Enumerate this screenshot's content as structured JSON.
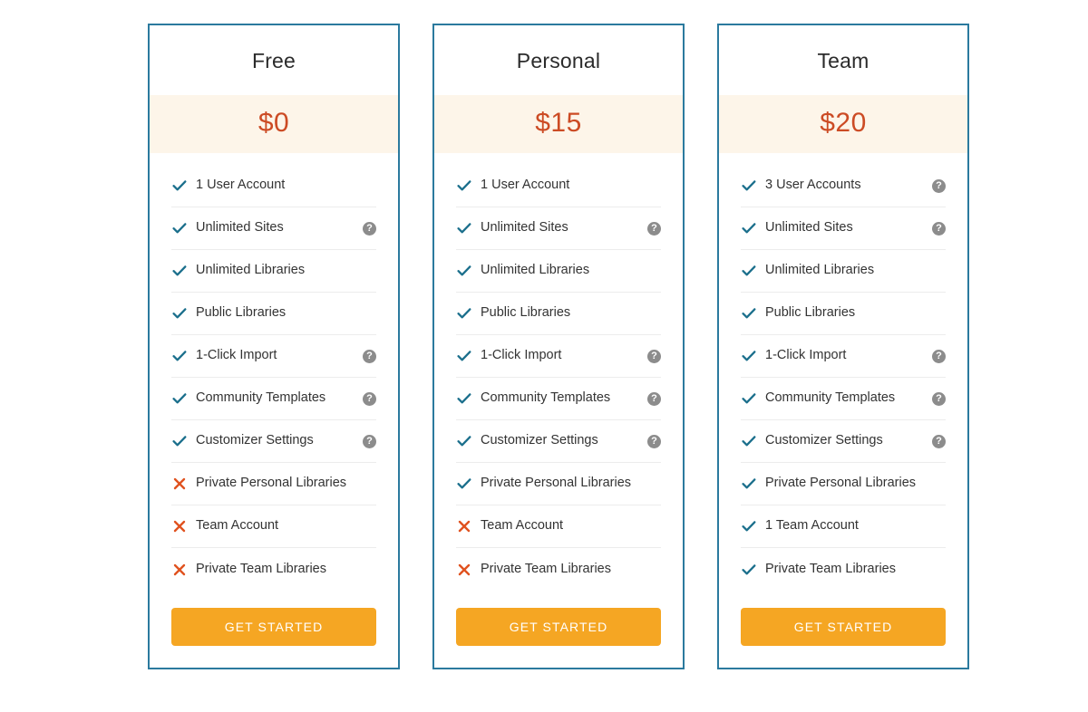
{
  "plans": [
    {
      "name": "Free",
      "price": "$0",
      "cta_label": "GET STARTED",
      "features": [
        {
          "label": "1 User Account",
          "mark": "check",
          "help": false
        },
        {
          "label": "Unlimited Sites",
          "mark": "check",
          "help": true
        },
        {
          "label": "Unlimited Libraries",
          "mark": "check",
          "help": false
        },
        {
          "label": "Public Libraries",
          "mark": "check",
          "help": false
        },
        {
          "label": "1-Click Import",
          "mark": "check",
          "help": true
        },
        {
          "label": "Community Templates",
          "mark": "check",
          "help": true
        },
        {
          "label": "Customizer Settings",
          "mark": "check",
          "help": true
        },
        {
          "label": "Private Personal Libraries",
          "mark": "cross",
          "help": false
        },
        {
          "label": "Team Account",
          "mark": "cross",
          "help": false
        },
        {
          "label": "Private Team Libraries",
          "mark": "cross",
          "help": false
        }
      ]
    },
    {
      "name": "Personal",
      "price": "$15",
      "cta_label": "GET STARTED",
      "features": [
        {
          "label": "1 User Account",
          "mark": "check",
          "help": false
        },
        {
          "label": "Unlimited Sites",
          "mark": "check",
          "help": true
        },
        {
          "label": "Unlimited Libraries",
          "mark": "check",
          "help": false
        },
        {
          "label": "Public Libraries",
          "mark": "check",
          "help": false
        },
        {
          "label": "1-Click Import",
          "mark": "check",
          "help": true
        },
        {
          "label": "Community Templates",
          "mark": "check",
          "help": true
        },
        {
          "label": "Customizer Settings",
          "mark": "check",
          "help": true
        },
        {
          "label": "Private Personal Libraries",
          "mark": "check",
          "help": false
        },
        {
          "label": "Team Account",
          "mark": "cross",
          "help": false
        },
        {
          "label": "Private Team Libraries",
          "mark": "cross",
          "help": false
        }
      ]
    },
    {
      "name": "Team",
      "price": "$20",
      "cta_label": "GET STARTED",
      "features": [
        {
          "label": "3 User Accounts",
          "mark": "check",
          "help": true
        },
        {
          "label": "Unlimited Sites",
          "mark": "check",
          "help": true
        },
        {
          "label": "Unlimited Libraries",
          "mark": "check",
          "help": false
        },
        {
          "label": "Public Libraries",
          "mark": "check",
          "help": false
        },
        {
          "label": "1-Click Import",
          "mark": "check",
          "help": true
        },
        {
          "label": "Community Templates",
          "mark": "check",
          "help": true
        },
        {
          "label": "Customizer Settings",
          "mark": "check",
          "help": true
        },
        {
          "label": "Private Personal Libraries",
          "mark": "check",
          "help": false
        },
        {
          "label": "1 Team Account",
          "mark": "check",
          "help": false
        },
        {
          "label": "Private Team Libraries",
          "mark": "check",
          "help": false
        }
      ]
    }
  ],
  "icons": {
    "help_glyph": "?",
    "check_name": "check-icon",
    "cross_name": "cross-icon",
    "help_name": "help-icon"
  },
  "colors": {
    "card_border": "#2b7a9e",
    "price_band": "#fdf5e9",
    "price_text": "#cc4b24",
    "check": "#1b6f8c",
    "cross": "#e0521f",
    "cta_background": "#f5a623",
    "cta_text": "#ffffff",
    "divider": "#ececec",
    "help_background": "#8c8c8c"
  }
}
